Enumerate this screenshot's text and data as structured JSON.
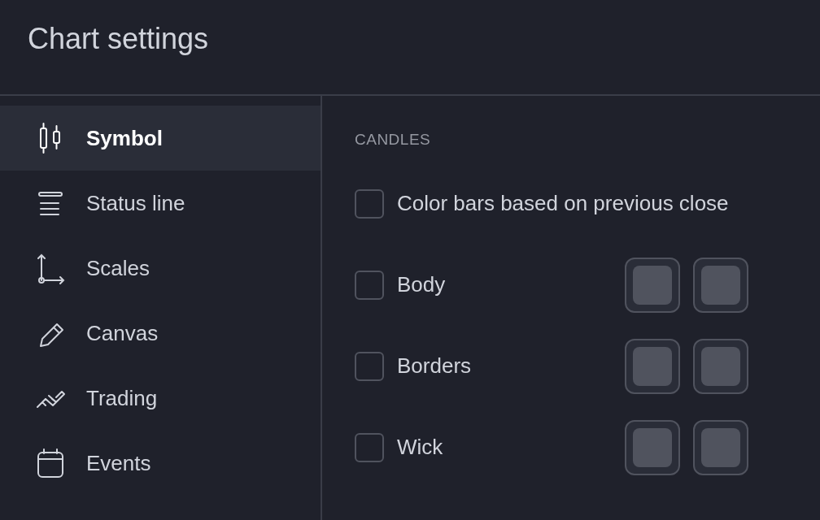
{
  "window": {
    "title": "Chart settings"
  },
  "sidebar": {
    "items": [
      {
        "label": "Symbol",
        "selected": true
      },
      {
        "label": "Status line",
        "selected": false
      },
      {
        "label": "Scales",
        "selected": false
      },
      {
        "label": "Canvas",
        "selected": false
      },
      {
        "label": "Trading",
        "selected": false
      },
      {
        "label": "Events",
        "selected": false
      }
    ]
  },
  "content": {
    "section": "CANDLES",
    "rows": [
      {
        "label": "Color bars based on previous close",
        "checked": false
      },
      {
        "label": "Body",
        "checked": false,
        "swatches": [
          {
            "color": "#50535e"
          },
          {
            "color": "#50535e"
          }
        ]
      },
      {
        "label": "Borders",
        "checked": false,
        "swatches": [
          {
            "color": "#50535e"
          },
          {
            "color": "#50535e"
          }
        ]
      },
      {
        "label": "Wick",
        "checked": false,
        "swatches": [
          {
            "color": "#50535e"
          },
          {
            "color": "#50535e"
          }
        ]
      }
    ]
  }
}
